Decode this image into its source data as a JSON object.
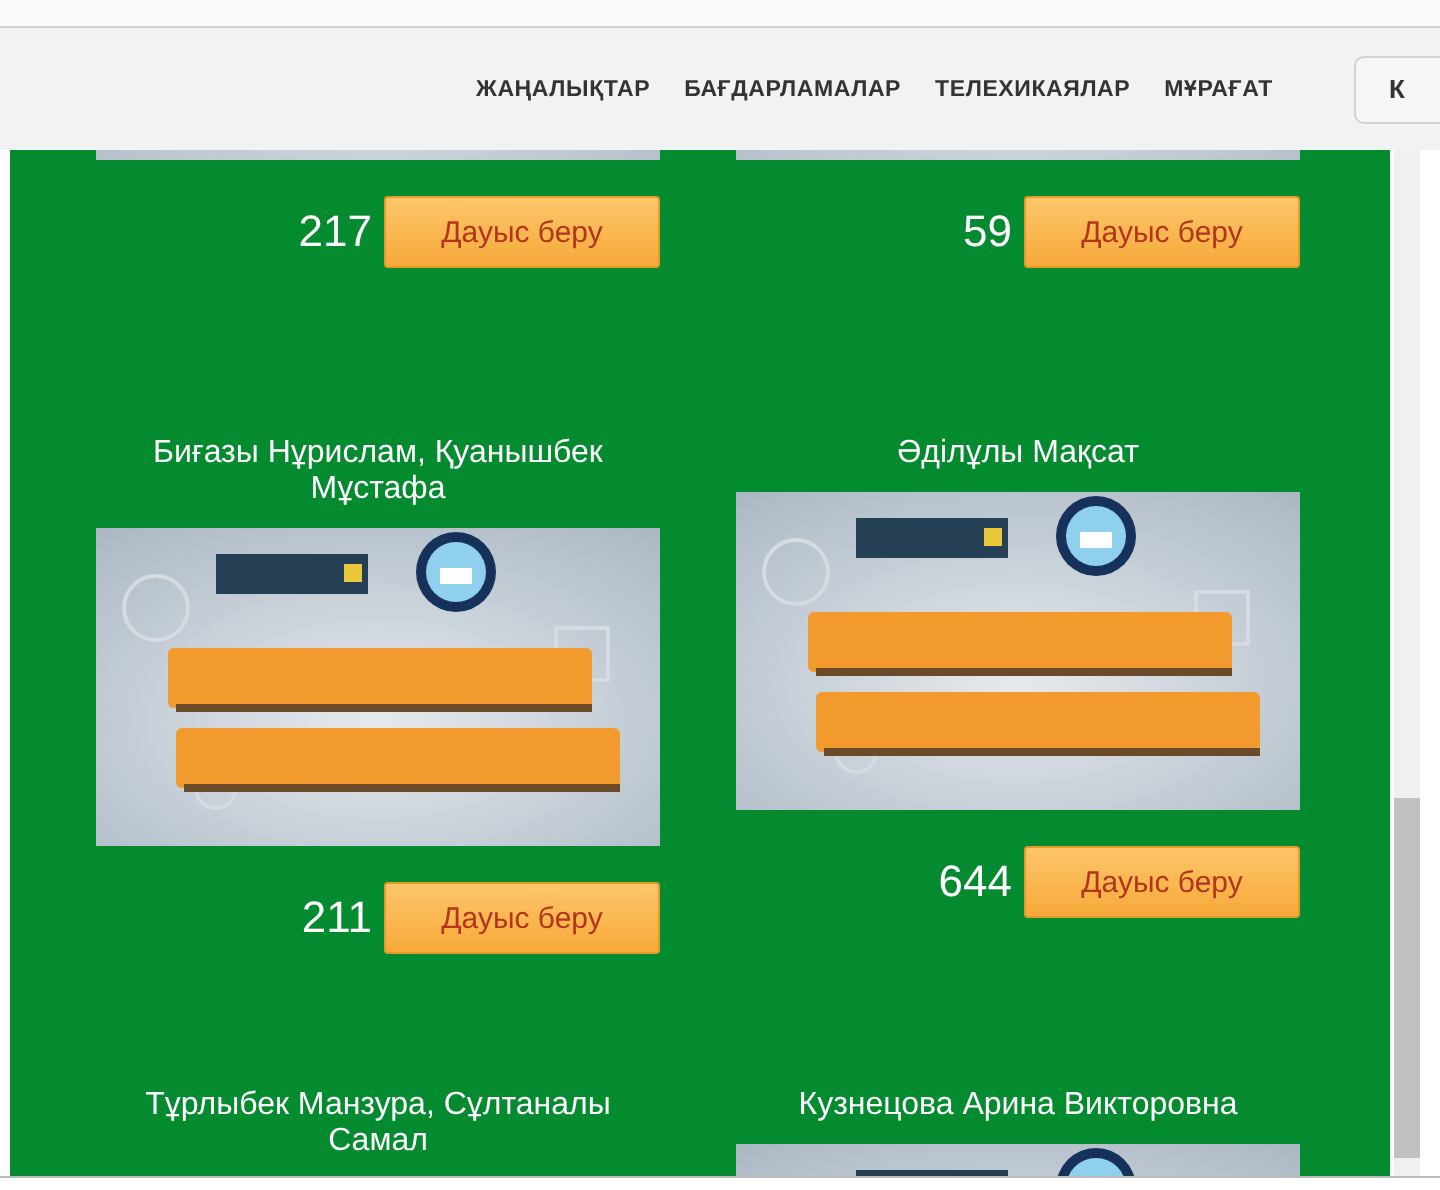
{
  "nav": {
    "links": [
      {
        "label": "ЖАҢАЛЫҚТАР"
      },
      {
        "label": "БАҒДАРЛАМАЛАР"
      },
      {
        "label": "ТЕЛЕХИКАЯЛАР"
      },
      {
        "label": "МҰРАҒАТ"
      }
    ],
    "button": "К"
  },
  "cards": [
    {
      "votes": "217",
      "vote_button": "Дауыс беру"
    },
    {
      "votes": "59",
      "vote_button": "Дауыс беру"
    },
    {
      "name": "Биғазы Нұрислам, Қуанышбек Мұстафа",
      "votes": "211",
      "vote_button": "Дауыс беру"
    },
    {
      "name": "Әділұлы Мақсат",
      "votes": "644",
      "vote_button": "Дауыс беру"
    },
    {
      "name": "Тұрлыбек Манзура, Сұлтаналы Самал"
    },
    {
      "name": "Кузнецова Арина Викторовна"
    }
  ]
}
